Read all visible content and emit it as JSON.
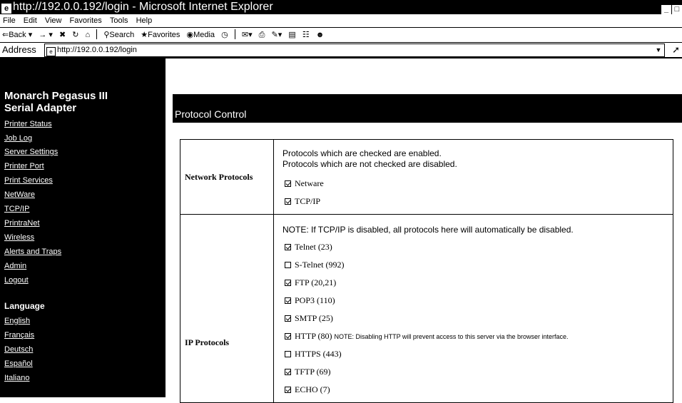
{
  "window": {
    "title": "http://192.0.0.192/login - Microsoft Internet Explorer"
  },
  "menu": [
    "File",
    "Edit",
    "View",
    "Favorites",
    "Tools",
    "Help"
  ],
  "toolbar": {
    "back": "Back",
    "search": "Search",
    "favorites": "Favorites",
    "media": "Media"
  },
  "address": {
    "label": "Address",
    "url": "http://192.0.0.192/login"
  },
  "sidebar": {
    "title_line1": "Monarch Pegasus III",
    "title_line2": "Serial Adapter",
    "links": [
      "Printer Status",
      "Job Log",
      "Server Settings",
      "Printer Port",
      "Print Services",
      "NetWare",
      "TCP/IP",
      "PrintraNet",
      "Wireless",
      "Alerts and Traps",
      "Admin",
      "Logout"
    ],
    "language_heading": "Language",
    "languages": [
      "English",
      "Français",
      "Deutsch",
      "Español",
      "Italiano"
    ]
  },
  "main": {
    "header": "Protocol Control",
    "network": {
      "label": "Network Protocols",
      "desc1": "Protocols which are checked are enabled.",
      "desc2": "Protocols which are not checked are disabled.",
      "items": [
        {
          "label": "Netware",
          "checked": true
        },
        {
          "label": "TCP/IP",
          "checked": true
        }
      ]
    },
    "ip": {
      "label": "IP Protocols",
      "note": "NOTE: If TCP/IP is disabled, all protocols here will automatically be disabled.",
      "items": [
        {
          "label": "Telnet (23)",
          "checked": true
        },
        {
          "label": "S-Telnet (992)",
          "checked": false
        },
        {
          "label": "FTP (20,21)",
          "checked": true
        },
        {
          "label": "POP3 (110)",
          "checked": true
        },
        {
          "label": "SMTP (25)",
          "checked": true
        },
        {
          "label": "HTTP (80)",
          "checked": true
        },
        {
          "label": "HTTPS (443)",
          "checked": false
        },
        {
          "label": "TFTP (69)",
          "checked": true
        },
        {
          "label": "ECHO (7)",
          "checked": true
        }
      ],
      "http_note": "NOTE: Disabling HTTP will prevent access to this server via the browser interface."
    }
  }
}
